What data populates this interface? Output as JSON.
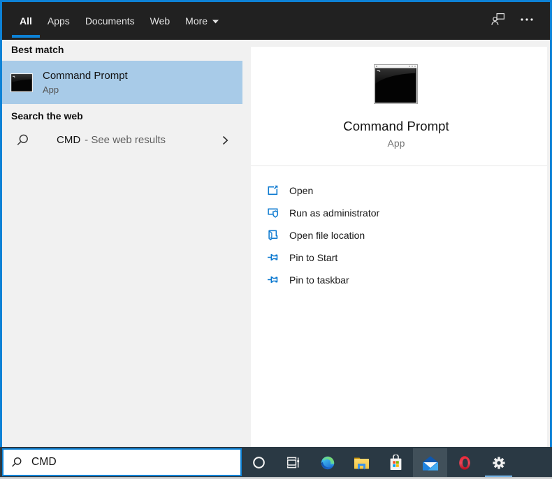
{
  "colors": {
    "accent_border": "#0d82d6",
    "selection_highlight": "#a8cbe8",
    "topbar_background": "#212121",
    "panel_background": "#f1f1f1",
    "taskbar_background": "#2a3944",
    "taskbar_hover_cell": "#41505a",
    "action_icon_blue": "#0b79d0",
    "taskbar_active_underline": "#76b5e7"
  },
  "topbar": {
    "tabs": [
      {
        "label": "All",
        "active": true
      },
      {
        "label": "Apps",
        "active": false
      },
      {
        "label": "Documents",
        "active": false
      },
      {
        "label": "Web",
        "active": false
      },
      {
        "label": "More",
        "active": false
      }
    ]
  },
  "left_panel": {
    "best_match_header": "Best match",
    "best_match": {
      "title": "Command Prompt",
      "type": "App"
    },
    "web_header": "Search the web",
    "web_result": {
      "query": "CMD",
      "suffix": "- See web results"
    }
  },
  "preview_panel": {
    "title": "Command Prompt",
    "type": "App",
    "actions": [
      {
        "label": "Open"
      },
      {
        "label": "Run as administrator"
      },
      {
        "label": "Open file location"
      },
      {
        "label": "Pin to Start"
      },
      {
        "label": "Pin to taskbar"
      }
    ]
  },
  "search_bar": {
    "value": "CMD"
  },
  "taskbar": {
    "apps": [
      "cortana",
      "task-view",
      "edge",
      "file-explorer",
      "microsoft-store",
      "mail",
      "opera",
      "settings"
    ],
    "hovered_app": "mail",
    "active_app": "settings"
  }
}
